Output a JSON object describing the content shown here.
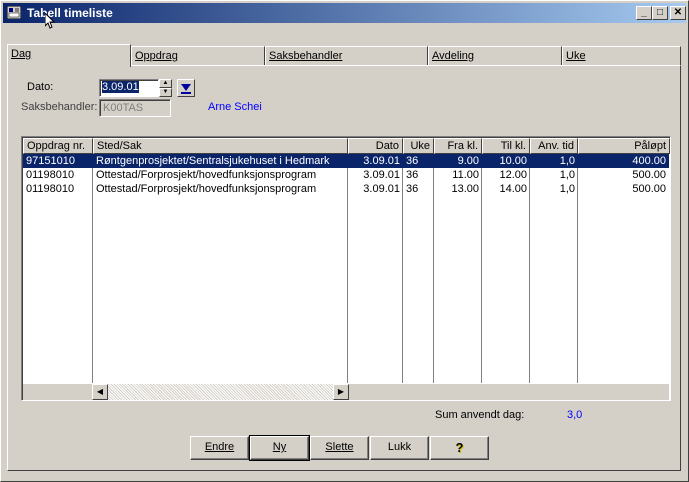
{
  "window": {
    "title": "Tabell timeliste"
  },
  "tabs": [
    {
      "label": "Dag",
      "active": true
    },
    {
      "label": "Oppdrag"
    },
    {
      "label": "Saksbehandler"
    },
    {
      "label": "Avdeling"
    },
    {
      "label": "Uke"
    }
  ],
  "form": {
    "dato_label": "Dato:",
    "dato_value": "3.09.01",
    "saksbehandler_label": "Saksbehandler:",
    "saksbehandler_value": "K00TAS",
    "saksbehandler_name": "Arne Schei"
  },
  "table": {
    "columns": [
      "Oppdrag nr.",
      "Sted/Sak",
      "Dato",
      "Uke",
      "Fra kl.",
      "Til kl.",
      "Anv. tid",
      "Påløpt"
    ],
    "rows": [
      [
        "97151010",
        "Røntgenprosjektet/Sentralsjukehuset i Hedmark",
        "3.09.01",
        "36",
        "9.00",
        "10.00",
        "1,0",
        "400.00"
      ],
      [
        "01198010",
        "Ottestad/Forprosjekt/hovedfunksjonsprogram",
        "3.09.01",
        "36",
        "11.00",
        "12.00",
        "1,0",
        "500.00"
      ],
      [
        "01198010",
        "Ottestad/Forprosjekt/hovedfunksjonsprogram",
        "3.09.01",
        "36",
        "13.00",
        "14.00",
        "1,0",
        "500.00"
      ]
    ]
  },
  "summary": {
    "label": "Sum anvendt dag:",
    "value": "3,0"
  },
  "buttons": {
    "endre": "Endre",
    "ny": "Ny",
    "slette": "Slette",
    "lukk": "Lukk",
    "help": "?"
  },
  "colors": {
    "title_start": "#0a246a",
    "title_end": "#a6caf0",
    "selection": "#0a246a",
    "accent_text": "#0000ff"
  }
}
